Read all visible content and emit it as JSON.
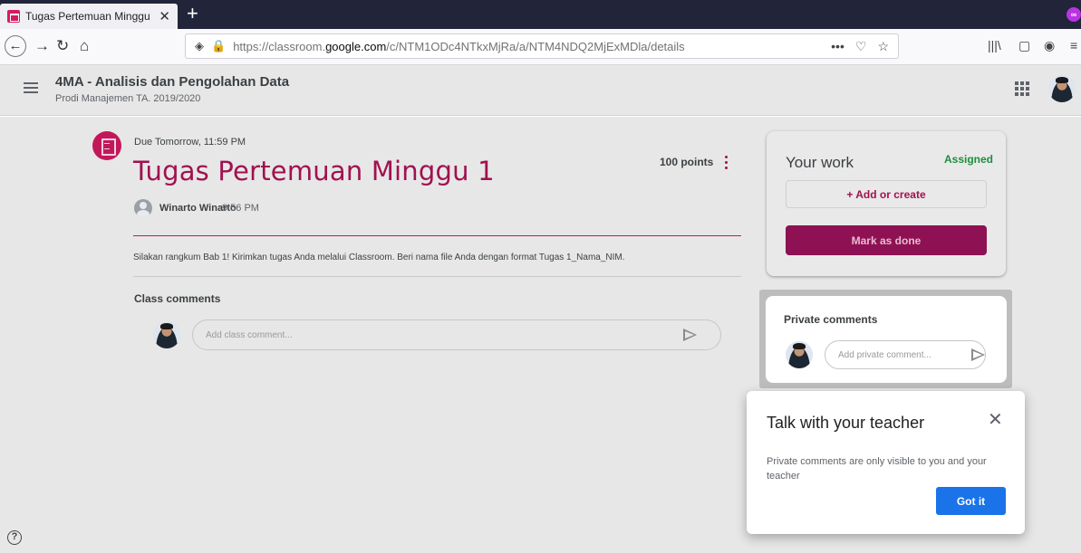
{
  "browser": {
    "tab_title": "Tugas Pertemuan Minggu 1",
    "tab_close": "✕",
    "new_tab": "+",
    "url_prefix": "https://classroom.",
    "url_domain": "google.com",
    "url_path": "/c/NTM1ODc4NTkxMjRa/a/NTM4NDQ2MjExMDla/details"
  },
  "header": {
    "class_name": "4MA - Analisis dan Pengolahan Data",
    "class_section": "Prodi Manajemen TA. 2019/2020"
  },
  "assignment": {
    "due": "Due Tomorrow, 11:59 PM",
    "title": "Tugas Pertemuan Minggu 1",
    "points": "100 points",
    "author": "Winarto Winarto",
    "posted_time": "9:56 PM",
    "instructions": "Silakan rangkum Bab 1! Kirimkan tugas Anda melalui Classroom. Beri nama file Anda dengan format Tugas 1_Nama_NIM."
  },
  "class_comments": {
    "heading": "Class comments",
    "placeholder": "Add class comment..."
  },
  "your_work": {
    "title": "Your work",
    "status": "Assigned",
    "add_label": "+  Add or create",
    "mark_done_label": "Mark as done",
    "status_color": "#1e8e3e",
    "accent_color": "#8e1153"
  },
  "private_comments": {
    "heading": "Private comments",
    "placeholder": "Add private comment..."
  },
  "dialog": {
    "title": "Talk with your teacher",
    "close": "✕",
    "body": "Private comments are only visible to you and your teacher",
    "button_label": "Got it",
    "button_color": "#1a73e8"
  },
  "footer": {
    "help": "?"
  }
}
